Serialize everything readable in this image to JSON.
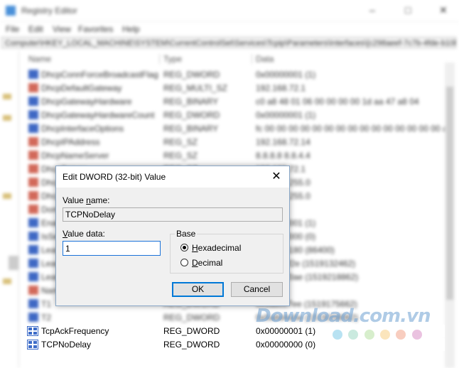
{
  "window": {
    "title": "Registry Editor",
    "menu": [
      "File",
      "Edit",
      "View",
      "Favorites",
      "Help"
    ],
    "address": "Computer\\HKEY_LOCAL_MACHINE\\SYSTEM\\CurrentControlSet\\Services\\Tcpip\\Parameters\\Interfaces\\{c298aeef-7c7b-4fde-b10b-a2ad0dc2bcd1}"
  },
  "columns": {
    "name": "Name",
    "type": "Type",
    "data": "Data"
  },
  "background_rows": [
    {
      "name": "DhcpConnForceBroadcastFlag",
      "type": "REG_DWORD",
      "data": "0x00000001 (1)",
      "icon": "binary"
    },
    {
      "name": "DhcpDefaultGateway",
      "type": "REG_MULTI_SZ",
      "data": "192.168.72.1",
      "icon": "string"
    },
    {
      "name": "DhcpGatewayHardware",
      "type": "REG_BINARY",
      "data": "c0 a8 48 01 06 00 00 00 00 1d aa 47 a8 04",
      "icon": "binary"
    },
    {
      "name": "DhcpGatewayHardwareCount",
      "type": "REG_DWORD",
      "data": "0x00000001 (1)",
      "icon": "binary"
    },
    {
      "name": "DhcpInterfaceOptions",
      "type": "REG_BINARY",
      "data": "fc 00 00 00 00 00 00 00 00 00 00 00 00 00 00 00 ac",
      "icon": "binary"
    },
    {
      "name": "DhcpIPAddress",
      "type": "REG_SZ",
      "data": "192.168.72.14",
      "icon": "string"
    },
    {
      "name": "DhcpNameServer",
      "type": "REG_SZ",
      "data": "8.8.8.8 8.8.4.4",
      "icon": "string"
    },
    {
      "name": "DhcpServer",
      "type": "REG_SZ",
      "data": "192.168.72.1",
      "icon": "string"
    },
    {
      "name": "DhcpSubnetMask",
      "type": "REG_SZ",
      "data": "255.255.255.0",
      "icon": "string"
    },
    {
      "name": "DhcpSubnetMaskOpt",
      "type": "REG_MULTI_SZ",
      "data": "255.255.255.0",
      "icon": "string"
    },
    {
      "name": "Domain",
      "type": "REG_SZ",
      "data": "",
      "icon": "string"
    },
    {
      "name": "EnableDHCP",
      "type": "REG_DWORD",
      "data": "0x00000001 (1)",
      "icon": "binary"
    },
    {
      "name": "IsServerNapAware",
      "type": "REG_DWORD",
      "data": "0x00000000 (0)",
      "icon": "binary"
    },
    {
      "name": "Lease",
      "type": "REG_DWORD",
      "data": "0x00015180 (86400)",
      "icon": "binary"
    },
    {
      "name": "LeaseObtainedTime",
      "type": "REG_DWORD",
      "data": "0x5a8c1f2e (1519132462)",
      "icon": "binary"
    },
    {
      "name": "LeaseTerminatesTime",
      "type": "REG_DWORD",
      "data": "0x5a8d70ae (1519218862)",
      "icon": "binary"
    },
    {
      "name": "NameServer",
      "type": "REG_SZ",
      "data": "",
      "icon": "string"
    },
    {
      "name": "T1",
      "type": "REG_DWORD",
      "data": "0x5a8cc7ee (1519175662)",
      "icon": "binary"
    },
    {
      "name": "T2",
      "type": "REG_DWORD",
      "data": "0x5a8d4a5e (1519208062)",
      "icon": "binary"
    }
  ],
  "visible_rows": [
    {
      "name": "TcpAckFrequency",
      "type": "REG_DWORD",
      "data": "0x00000001 (1)"
    },
    {
      "name": "TCPNoDelay",
      "type": "REG_DWORD",
      "data": "0x00000000 (0)"
    }
  ],
  "dialog": {
    "title": "Edit DWORD (32-bit) Value",
    "value_name_label_pre": "Value ",
    "value_name_label_key": "n",
    "value_name_label_post": "ame:",
    "value_name": "TCPNoDelay",
    "value_data_label_pre": "",
    "value_data_label_key": "V",
    "value_data_label_post": "alue data:",
    "value_data": "1",
    "base_label": "Base",
    "hex_label_key": "H",
    "hex_label_rest": "exadecimal",
    "dec_label_key": "D",
    "dec_label_rest": "ecimal",
    "ok_label": "OK",
    "cancel_label": "Cancel",
    "base_selected": "hexadecimal"
  },
  "watermark": {
    "text": "Download.com.vn",
    "dot_colors": [
      "#7ecbe8",
      "#9fd8c4",
      "#b6e0a3",
      "#f7cf85",
      "#f2a48a",
      "#d88fc6"
    ]
  }
}
